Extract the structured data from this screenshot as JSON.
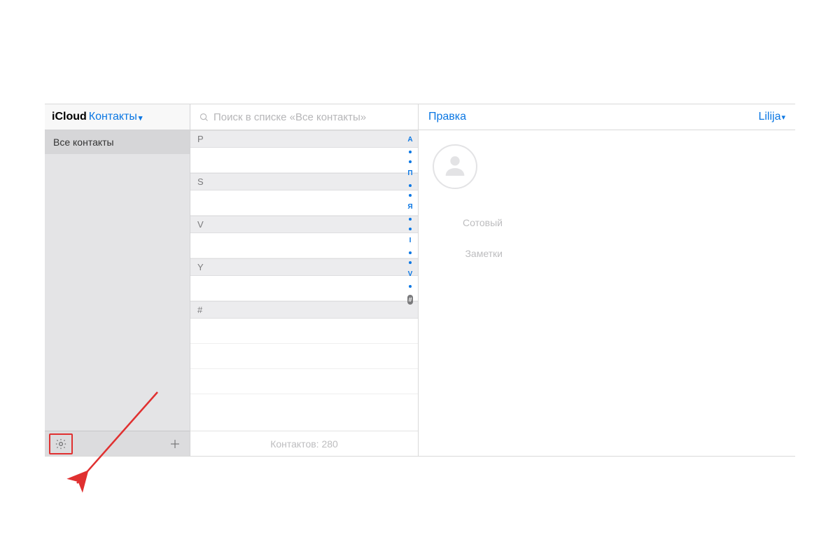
{
  "header": {
    "brand": "iCloud",
    "section": "Контакты"
  },
  "sidebar": {
    "groups": [
      "Все контакты"
    ]
  },
  "search": {
    "placeholder": "Поиск в списке «Все контакты»"
  },
  "list": {
    "sections": [
      "P",
      "S",
      "V",
      "Y",
      "#"
    ],
    "footer": "Контактов: 280"
  },
  "alpha_index": [
    "А",
    "dot",
    "dot",
    "П",
    "dot",
    "dot",
    "Я",
    "dot",
    "dot",
    "I",
    "dot",
    "dot",
    "V",
    "dot",
    "#"
  ],
  "detail": {
    "edit_label": "Правка",
    "account_label": "Lilija",
    "fields": {
      "mobile_label": "Сотовый",
      "notes_label": "Заметки"
    }
  },
  "annotation": {
    "target": "settings-gear"
  }
}
